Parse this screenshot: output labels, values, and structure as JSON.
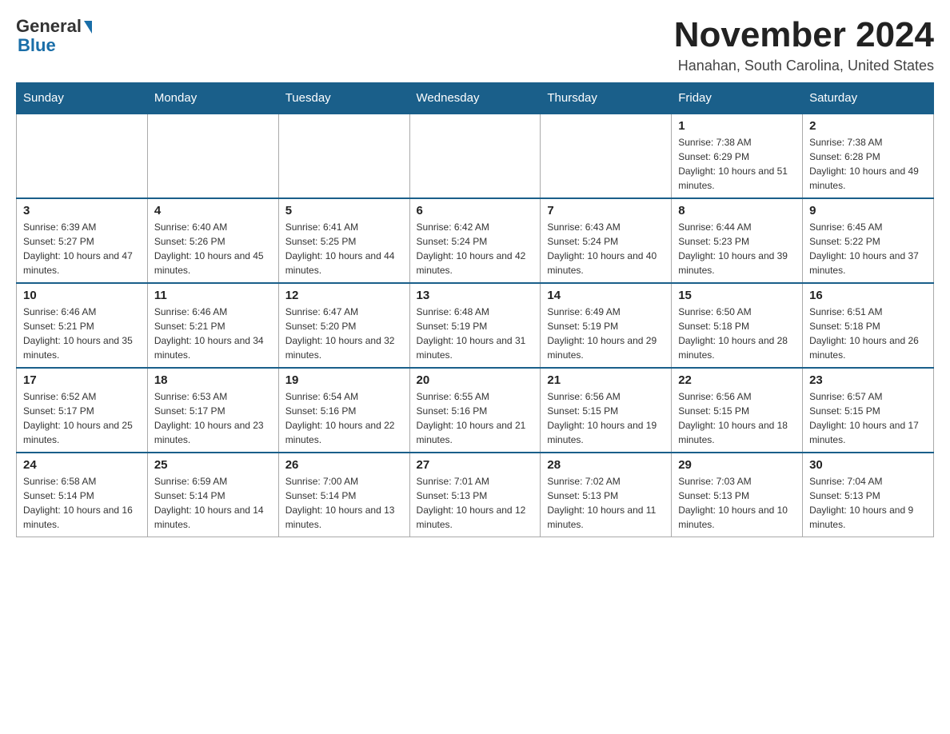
{
  "logo": {
    "general": "General",
    "blue": "Blue"
  },
  "title": "November 2024",
  "subtitle": "Hanahan, South Carolina, United States",
  "days_of_week": [
    "Sunday",
    "Monday",
    "Tuesday",
    "Wednesday",
    "Thursday",
    "Friday",
    "Saturday"
  ],
  "weeks": [
    [
      {
        "day": "",
        "info": ""
      },
      {
        "day": "",
        "info": ""
      },
      {
        "day": "",
        "info": ""
      },
      {
        "day": "",
        "info": ""
      },
      {
        "day": "",
        "info": ""
      },
      {
        "day": "1",
        "info": "Sunrise: 7:38 AM\nSunset: 6:29 PM\nDaylight: 10 hours and 51 minutes."
      },
      {
        "day": "2",
        "info": "Sunrise: 7:38 AM\nSunset: 6:28 PM\nDaylight: 10 hours and 49 minutes."
      }
    ],
    [
      {
        "day": "3",
        "info": "Sunrise: 6:39 AM\nSunset: 5:27 PM\nDaylight: 10 hours and 47 minutes."
      },
      {
        "day": "4",
        "info": "Sunrise: 6:40 AM\nSunset: 5:26 PM\nDaylight: 10 hours and 45 minutes."
      },
      {
        "day": "5",
        "info": "Sunrise: 6:41 AM\nSunset: 5:25 PM\nDaylight: 10 hours and 44 minutes."
      },
      {
        "day": "6",
        "info": "Sunrise: 6:42 AM\nSunset: 5:24 PM\nDaylight: 10 hours and 42 minutes."
      },
      {
        "day": "7",
        "info": "Sunrise: 6:43 AM\nSunset: 5:24 PM\nDaylight: 10 hours and 40 minutes."
      },
      {
        "day": "8",
        "info": "Sunrise: 6:44 AM\nSunset: 5:23 PM\nDaylight: 10 hours and 39 minutes."
      },
      {
        "day": "9",
        "info": "Sunrise: 6:45 AM\nSunset: 5:22 PM\nDaylight: 10 hours and 37 minutes."
      }
    ],
    [
      {
        "day": "10",
        "info": "Sunrise: 6:46 AM\nSunset: 5:21 PM\nDaylight: 10 hours and 35 minutes."
      },
      {
        "day": "11",
        "info": "Sunrise: 6:46 AM\nSunset: 5:21 PM\nDaylight: 10 hours and 34 minutes."
      },
      {
        "day": "12",
        "info": "Sunrise: 6:47 AM\nSunset: 5:20 PM\nDaylight: 10 hours and 32 minutes."
      },
      {
        "day": "13",
        "info": "Sunrise: 6:48 AM\nSunset: 5:19 PM\nDaylight: 10 hours and 31 minutes."
      },
      {
        "day": "14",
        "info": "Sunrise: 6:49 AM\nSunset: 5:19 PM\nDaylight: 10 hours and 29 minutes."
      },
      {
        "day": "15",
        "info": "Sunrise: 6:50 AM\nSunset: 5:18 PM\nDaylight: 10 hours and 28 minutes."
      },
      {
        "day": "16",
        "info": "Sunrise: 6:51 AM\nSunset: 5:18 PM\nDaylight: 10 hours and 26 minutes."
      }
    ],
    [
      {
        "day": "17",
        "info": "Sunrise: 6:52 AM\nSunset: 5:17 PM\nDaylight: 10 hours and 25 minutes."
      },
      {
        "day": "18",
        "info": "Sunrise: 6:53 AM\nSunset: 5:17 PM\nDaylight: 10 hours and 23 minutes."
      },
      {
        "day": "19",
        "info": "Sunrise: 6:54 AM\nSunset: 5:16 PM\nDaylight: 10 hours and 22 minutes."
      },
      {
        "day": "20",
        "info": "Sunrise: 6:55 AM\nSunset: 5:16 PM\nDaylight: 10 hours and 21 minutes."
      },
      {
        "day": "21",
        "info": "Sunrise: 6:56 AM\nSunset: 5:15 PM\nDaylight: 10 hours and 19 minutes."
      },
      {
        "day": "22",
        "info": "Sunrise: 6:56 AM\nSunset: 5:15 PM\nDaylight: 10 hours and 18 minutes."
      },
      {
        "day": "23",
        "info": "Sunrise: 6:57 AM\nSunset: 5:15 PM\nDaylight: 10 hours and 17 minutes."
      }
    ],
    [
      {
        "day": "24",
        "info": "Sunrise: 6:58 AM\nSunset: 5:14 PM\nDaylight: 10 hours and 16 minutes."
      },
      {
        "day": "25",
        "info": "Sunrise: 6:59 AM\nSunset: 5:14 PM\nDaylight: 10 hours and 14 minutes."
      },
      {
        "day": "26",
        "info": "Sunrise: 7:00 AM\nSunset: 5:14 PM\nDaylight: 10 hours and 13 minutes."
      },
      {
        "day": "27",
        "info": "Sunrise: 7:01 AM\nSunset: 5:13 PM\nDaylight: 10 hours and 12 minutes."
      },
      {
        "day": "28",
        "info": "Sunrise: 7:02 AM\nSunset: 5:13 PM\nDaylight: 10 hours and 11 minutes."
      },
      {
        "day": "29",
        "info": "Sunrise: 7:03 AM\nSunset: 5:13 PM\nDaylight: 10 hours and 10 minutes."
      },
      {
        "day": "30",
        "info": "Sunrise: 7:04 AM\nSunset: 5:13 PM\nDaylight: 10 hours and 9 minutes."
      }
    ]
  ]
}
